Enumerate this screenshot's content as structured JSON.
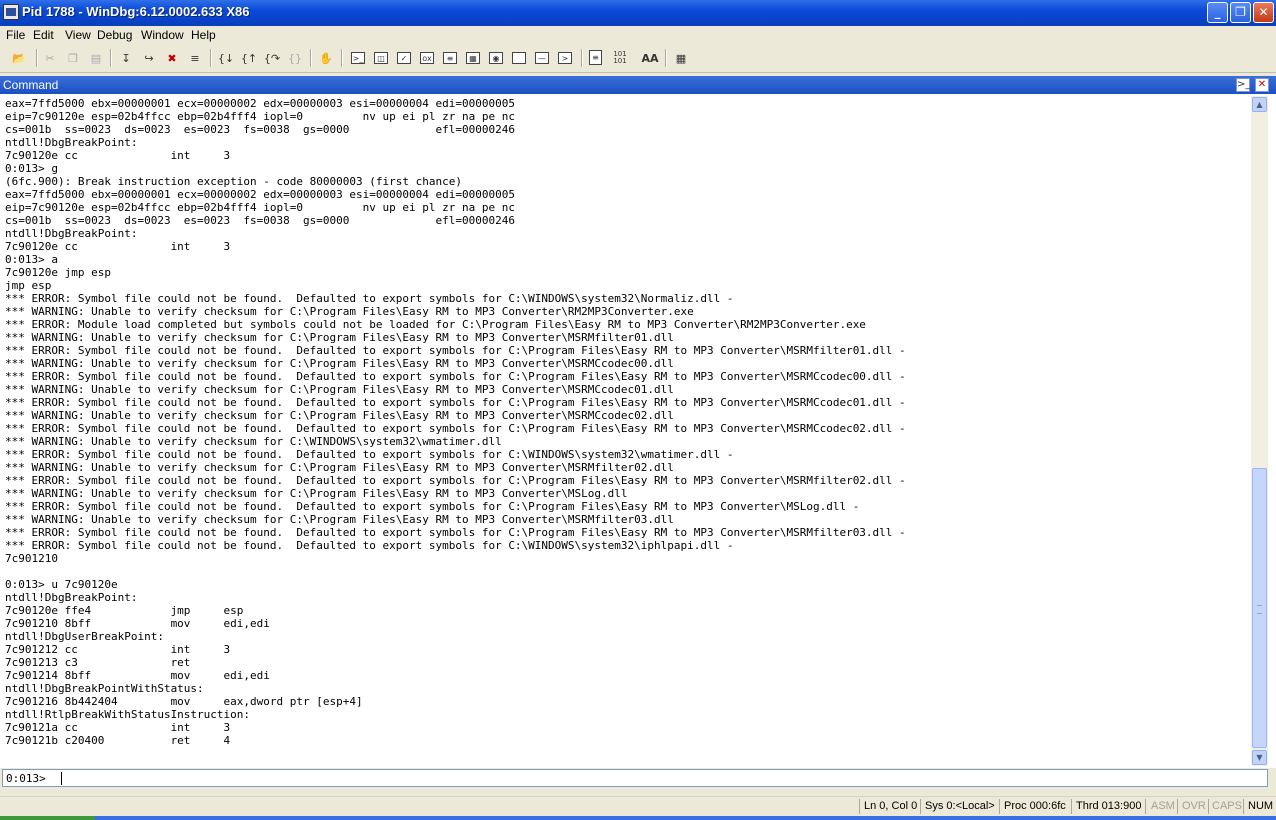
{
  "window": {
    "title": "Pid 1788 - WinDbg:6.12.0002.633 X86",
    "minimize": "_",
    "maximize": "❐",
    "close": "✕"
  },
  "menu": [
    "File",
    "Edit",
    "View",
    "Debug",
    "Window",
    "Help"
  ],
  "toolbar": {
    "icons": [
      "open-icon",
      "cut-icon",
      "copy-icon",
      "paste-icon",
      "step-into-icon",
      "step-over-icon",
      "stop-debugging-icon",
      "break-icon",
      "go-icon",
      "step-out-icon",
      "run-to-cursor-icon",
      "source-mode-icon",
      "hand-icon",
      "command-icon",
      "watch-icon",
      "locals-icon",
      "registers-icon",
      "memory-icon",
      "call-stack-icon",
      "disassembly-icon",
      "scratch-pad-icon",
      "source-mode-toggle-icon",
      "hex-display-icon",
      "font-icon",
      "options-icon"
    ],
    "hex_label": "101\n101",
    "font_label": "AA"
  },
  "command": {
    "title": "Command",
    "lines": [
      "eax=7ffd5000 ebx=00000001 ecx=00000002 edx=00000003 esi=00000004 edi=00000005",
      "eip=7c90120e esp=02b4ffcc ebp=02b4fff4 iopl=0         nv up ei pl zr na pe nc",
      "cs=001b  ss=0023  ds=0023  es=0023  fs=0038  gs=0000             efl=00000246",
      "ntdll!DbgBreakPoint:",
      "7c90120e cc              int     3",
      "0:013> g",
      "(6fc.900): Break instruction exception - code 80000003 (first chance)",
      "eax=7ffd5000 ebx=00000001 ecx=00000002 edx=00000003 esi=00000004 edi=00000005",
      "eip=7c90120e esp=02b4ffcc ebp=02b4fff4 iopl=0         nv up ei pl zr na pe nc",
      "cs=001b  ss=0023  ds=0023  es=0023  fs=0038  gs=0000             efl=00000246",
      "ntdll!DbgBreakPoint:",
      "7c90120e cc              int     3",
      "0:013> a",
      "7c90120e jmp esp",
      "jmp esp",
      "*** ERROR: Symbol file could not be found.  Defaulted to export symbols for C:\\WINDOWS\\system32\\Normaliz.dll -",
      "*** WARNING: Unable to verify checksum for C:\\Program Files\\Easy RM to MP3 Converter\\RM2MP3Converter.exe",
      "*** ERROR: Module load completed but symbols could not be loaded for C:\\Program Files\\Easy RM to MP3 Converter\\RM2MP3Converter.exe",
      "*** WARNING: Unable to verify checksum for C:\\Program Files\\Easy RM to MP3 Converter\\MSRMfilter01.dll",
      "*** ERROR: Symbol file could not be found.  Defaulted to export symbols for C:\\Program Files\\Easy RM to MP3 Converter\\MSRMfilter01.dll -",
      "*** WARNING: Unable to verify checksum for C:\\Program Files\\Easy RM to MP3 Converter\\MSRMCcodec00.dll",
      "*** ERROR: Symbol file could not be found.  Defaulted to export symbols for C:\\Program Files\\Easy RM to MP3 Converter\\MSRMCcodec00.dll -",
      "*** WARNING: Unable to verify checksum for C:\\Program Files\\Easy RM to MP3 Converter\\MSRMCcodec01.dll",
      "*** ERROR: Symbol file could not be found.  Defaulted to export symbols for C:\\Program Files\\Easy RM to MP3 Converter\\MSRMCcodec01.dll -",
      "*** WARNING: Unable to verify checksum for C:\\Program Files\\Easy RM to MP3 Converter\\MSRMCcodec02.dll",
      "*** ERROR: Symbol file could not be found.  Defaulted to export symbols for C:\\Program Files\\Easy RM to MP3 Converter\\MSRMCcodec02.dll -",
      "*** WARNING: Unable to verify checksum for C:\\WINDOWS\\system32\\wmatimer.dll",
      "*** ERROR: Symbol file could not be found.  Defaulted to export symbols for C:\\WINDOWS\\system32\\wmatimer.dll -",
      "*** WARNING: Unable to verify checksum for C:\\Program Files\\Easy RM to MP3 Converter\\MSRMfilter02.dll",
      "*** ERROR: Symbol file could not be found.  Defaulted to export symbols for C:\\Program Files\\Easy RM to MP3 Converter\\MSRMfilter02.dll -",
      "*** WARNING: Unable to verify checksum for C:\\Program Files\\Easy RM to MP3 Converter\\MSLog.dll",
      "*** ERROR: Symbol file could not be found.  Defaulted to export symbols for C:\\Program Files\\Easy RM to MP3 Converter\\MSLog.dll -",
      "*** WARNING: Unable to verify checksum for C:\\Program Files\\Easy RM to MP3 Converter\\MSRMfilter03.dll",
      "*** ERROR: Symbol file could not be found.  Defaulted to export symbols for C:\\Program Files\\Easy RM to MP3 Converter\\MSRMfilter03.dll -",
      "*** ERROR: Symbol file could not be found.  Defaulted to export symbols for C:\\WINDOWS\\system32\\iphlpapi.dll -",
      "7c901210",
      "",
      "0:013> u 7c90120e",
      "ntdll!DbgBreakPoint:",
      "7c90120e ffe4            jmp     esp",
      "7c901210 8bff            mov     edi,edi",
      "ntdll!DbgUserBreakPoint:",
      "7c901212 cc              int     3",
      "7c901213 c3              ret",
      "7c901214 8bff            mov     edi,edi",
      "ntdll!DbgBreakPointWithStatus:",
      "7c901216 8b442404        mov     eax,dword ptr [esp+4]",
      "ntdll!RtlpBreakWithStatusInstruction:",
      "7c90121a cc              int     3",
      "7c90121b c20400          ret     4"
    ],
    "prompt": "0:013>",
    "input_value": ""
  },
  "status": {
    "position": "Ln 0, Col 0",
    "sys": "Sys 0:<Local>",
    "proc": "Proc 000:6fc",
    "thrd": "Thrd 013:900",
    "asm": "ASM",
    "ovr": "OVR",
    "caps": "CAPS",
    "num": "NUM"
  }
}
